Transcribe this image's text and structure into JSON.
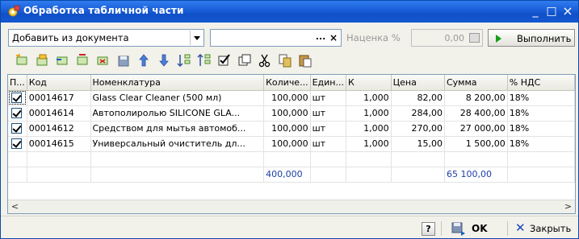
{
  "window": {
    "title": "Обработка табличной части",
    "controls": [
      "_",
      "□",
      "×"
    ]
  },
  "top": {
    "action_value": "Добавить из документа",
    "doc_value": "",
    "doc_select_glyph": "...",
    "doc_clear_glyph": "×",
    "markup_label": "Наценка %",
    "markup_value": "0,00",
    "run_label": "Выполнить"
  },
  "toolbar": {
    "icons": [
      "add-row-icon",
      "copy-row-icon",
      "insert-row-icon",
      "edit-row-icon",
      "delete-row-icon",
      "save-icon",
      "move-up-icon",
      "move-down-icon",
      "sort-asc-icon",
      "sort-desc-icon",
      "check-all-icon",
      "uncheck-all-icon",
      "cut-icon",
      "copy-icon",
      "paste-icon"
    ]
  },
  "grid": {
    "columns": [
      "П...",
      "Код",
      "Номенклатура",
      "Количе...",
      "Един...",
      "К",
      "Цена",
      "Сумма",
      "% НДС"
    ],
    "rows": [
      {
        "checked": true,
        "code": "00014617",
        "name": "Glass Clear Cleaner (500 мл)",
        "qty": "100,000",
        "unit": "шт",
        "k": "1,000",
        "price": "82,00",
        "sum": "8 200,00",
        "vat": "18%"
      },
      {
        "checked": true,
        "code": "00014614",
        "name": "Автополиролью SILICONE GLA...",
        "qty": "100,000",
        "unit": "шт",
        "k": "1,000",
        "price": "284,00",
        "sum": "28 400,00",
        "vat": "18%"
      },
      {
        "checked": true,
        "code": "00014612",
        "name": "Средством для мытья автомоб...",
        "qty": "100,000",
        "unit": "шт",
        "k": "1,000",
        "price": "270,00",
        "sum": "27 000,00",
        "vat": "18%"
      },
      {
        "checked": true,
        "code": "00014615",
        "name": "Универсальный очиститель дл...",
        "qty": "100,000",
        "unit": "шт",
        "k": "1,000",
        "price": "15,00",
        "sum": "1 500,00",
        "vat": "18%"
      }
    ],
    "totals": {
      "qty": "400,000",
      "sum": "65 100,00"
    },
    "scroll_left": "<",
    "scroll_right": ">"
  },
  "footer": {
    "help": "?",
    "ok_label": "OK",
    "close_label": "Закрыть"
  },
  "colors": {
    "titlebar": "#1a5dd8",
    "totals_text": "#1a3fa6",
    "run_icon": "#14a014"
  }
}
